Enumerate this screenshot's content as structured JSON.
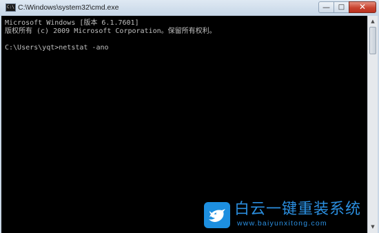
{
  "window": {
    "title": "C:\\Windows\\system32\\cmd.exe",
    "icon": "cmd-icon",
    "icon_prompt": "C:\\",
    "minimize_glyph": "—",
    "maximize_glyph": "□",
    "close_glyph": "✕"
  },
  "console": {
    "lines": [
      "Microsoft Windows [版本 6.1.7601]",
      "版权所有 (c) 2009 Microsoft Corporation。保留所有权利。",
      "",
      "C:\\Users\\yqt>netstat -ano"
    ]
  },
  "scrollbar": {
    "up_glyph": "▲",
    "down_glyph": "▼"
  },
  "watermark": {
    "logo": "bird-icon",
    "title": "白云一键重装系统",
    "url": "www.baiyunxitong.com"
  },
  "colors": {
    "console_bg": "#000000",
    "console_text": "#c0c0c0",
    "titlebar": "#c9d7e6",
    "close_button": "#c94531",
    "watermark": "#2b8fe0"
  }
}
